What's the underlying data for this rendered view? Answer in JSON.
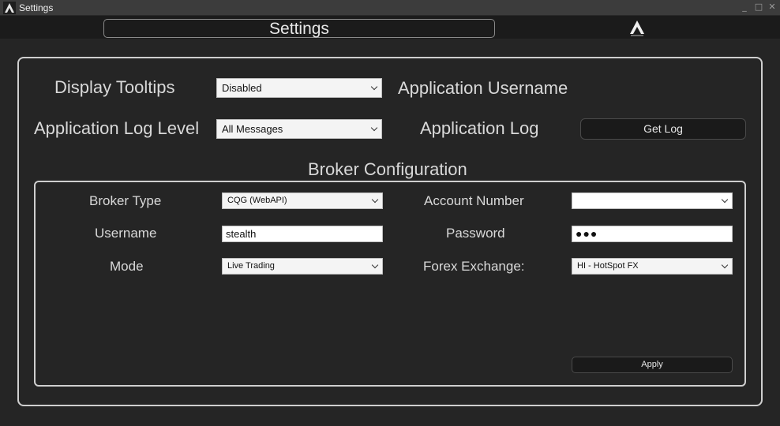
{
  "window": {
    "title": "Settings",
    "controls": {
      "minimize": "_",
      "maximize": "□",
      "close": "✕"
    }
  },
  "header": {
    "title": "Settings",
    "logo": "app-logo-icon"
  },
  "general": {
    "display_tooltips_label": "Display Tooltips",
    "display_tooltips_value": "Disabled",
    "app_username_label": "Application Username",
    "log_level_label": "Application Log Level",
    "log_level_value": "All Messages",
    "app_log_label": "Application Log",
    "get_log_button": "Get Log"
  },
  "broker": {
    "section_title": "Broker Configuration",
    "broker_type_label": "Broker Type",
    "broker_type_value": "CQG (WebAPI)",
    "account_number_label": "Account Number",
    "account_number_value": "",
    "username_label": "Username",
    "username_value": "stealth",
    "password_label": "Password",
    "password_value": "●●●",
    "mode_label": "Mode",
    "mode_value": "Live Trading",
    "forex_label": "Forex Exchange:",
    "forex_value": "HI - HotSpot FX",
    "apply_button": "Apply"
  },
  "colors": {
    "background": "#252525",
    "header_band": "#1b1b1b",
    "titlebar": "#3c3c3c",
    "panel_border": "#cfcfcf",
    "button_bg": "#1a1a1a"
  }
}
